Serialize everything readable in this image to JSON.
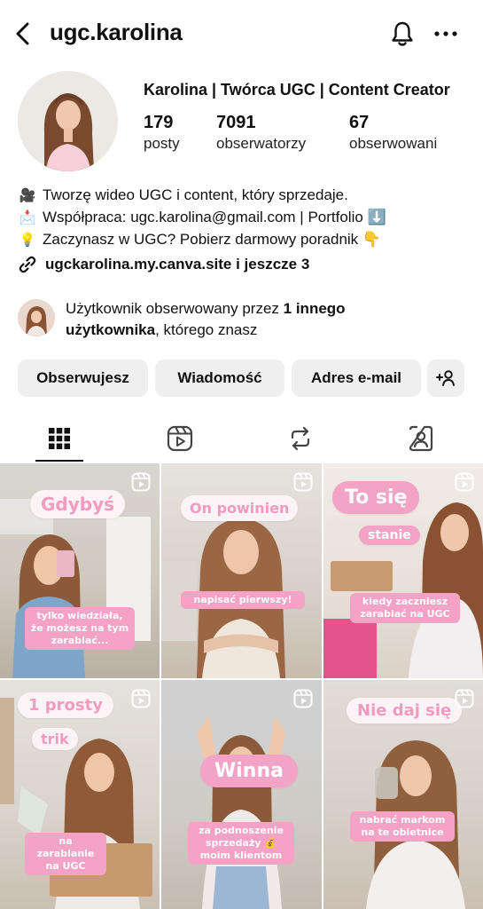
{
  "header": {
    "username": "ugc.karolina"
  },
  "profile": {
    "full_name": "Karolina | Twórca UGC | Content Creator",
    "stats": [
      {
        "value": "179",
        "label": "posty"
      },
      {
        "value": "7091",
        "label": "obserwatorzy"
      },
      {
        "value": "67",
        "label": "obserwowani"
      }
    ],
    "bio": [
      {
        "icon": "movie-camera-emoji",
        "text": "Tworzę wideo UGC i content, który sprzedaje."
      },
      {
        "icon": "envelope-emoji",
        "text": "Współpraca: ugc.karolina@gmail.com | Portfolio ⬇️"
      },
      {
        "icon": "lightbulb-emoji",
        "text": "Zaczynasz w UGC? Pobierz darmowy poradnik 👇"
      }
    ],
    "link": "ugckarolina.my.canva.site i jeszcze 3",
    "followed_by": {
      "pre": "Użytkownik obserwowany przez ",
      "bold1": "1 innego",
      "bold2": "użytkownika",
      "post": ", którego znasz"
    }
  },
  "buttons": {
    "following": "Obserwujesz",
    "message": "Wiadomość",
    "email": "Adres e-mail"
  },
  "tabs": [
    {
      "name": "grid-icon",
      "active": true
    },
    {
      "name": "reels-icon",
      "active": false
    },
    {
      "name": "reposts-icon",
      "active": false
    },
    {
      "name": "tagged-icon",
      "active": false
    }
  ],
  "posts": [
    {
      "headline": "Gdybyś",
      "caption": "tylko wiedziała, że możesz na tym zarabiać..."
    },
    {
      "headline": "On powinien",
      "caption": "napisać pierwszy!"
    },
    {
      "headline": "To się",
      "headline2": "stanie",
      "caption": "kiedy zaczniesz zarabiać na UGC"
    },
    {
      "headline": "1 prosty",
      "headline2": "trik",
      "caption": "na zarabianie na UGC"
    },
    {
      "headline": "Winna",
      "caption": "za podnoszenie sprzedaży 💰 moim klientom"
    },
    {
      "headline": "Nie daj się",
      "caption": "nabrać markom na te obietnice"
    }
  ],
  "colors": {
    "accent_pink": "#f39ac1",
    "button_bg": "#efefef"
  }
}
